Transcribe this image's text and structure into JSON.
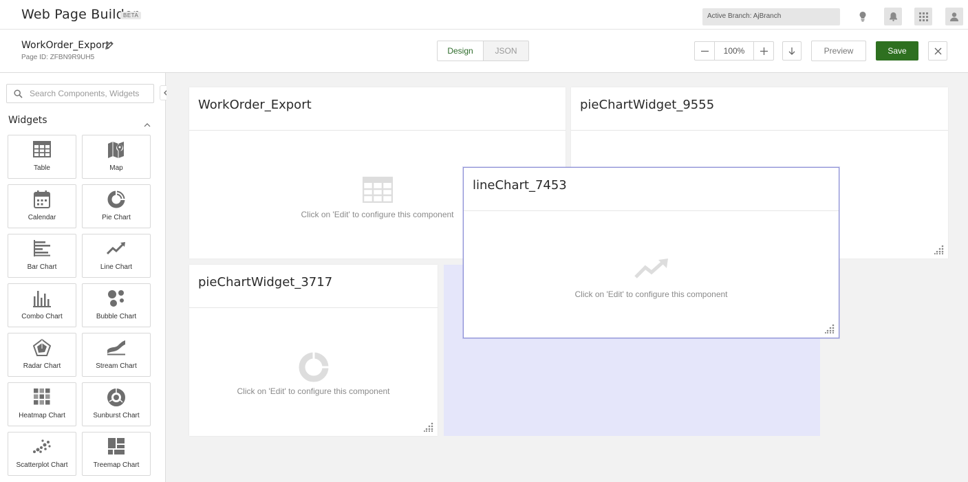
{
  "app": {
    "title": "Web Page Builder",
    "badge": "BETA",
    "active_branch": "Active Branch: AjBranch"
  },
  "page": {
    "name": "WorkOrder_Export",
    "id_label": "Page ID: ZFBN9R9UH5"
  },
  "view_toggle": {
    "design": "Design",
    "json": "JSON",
    "selected": "Design"
  },
  "zoom": {
    "value": "100%"
  },
  "actions": {
    "preview": "Preview",
    "save": "Save"
  },
  "colors": {
    "save": "#2e7020",
    "selected_tab_text": "#2d6b2a",
    "drop_zone": "#e5e6fa",
    "active_border": "#8c8fd6"
  },
  "sidebar": {
    "search_placeholder": "Search Components, Widgets",
    "section_title": "Widgets",
    "widgets": [
      {
        "label": "Table",
        "icon": "table-icon"
      },
      {
        "label": "Map",
        "icon": "map-icon"
      },
      {
        "label": "Calendar",
        "icon": "calendar-icon"
      },
      {
        "label": "Pie Chart",
        "icon": "pie-chart-icon"
      },
      {
        "label": "Bar Chart",
        "icon": "bar-chart-icon"
      },
      {
        "label": "Line Chart",
        "icon": "line-chart-icon"
      },
      {
        "label": "Combo Chart",
        "icon": "combo-chart-icon"
      },
      {
        "label": "Bubble Chart",
        "icon": "bubble-chart-icon"
      },
      {
        "label": "Radar Chart",
        "icon": "radar-chart-icon"
      },
      {
        "label": "Stream Chart",
        "icon": "stream-chart-icon"
      },
      {
        "label": "Heatmap Chart",
        "icon": "heatmap-chart-icon"
      },
      {
        "label": "Sunburst Chart",
        "icon": "sunburst-chart-icon"
      },
      {
        "label": "Scatterplot Chart",
        "icon": "scatterplot-chart-icon"
      },
      {
        "label": "Treemap Chart",
        "icon": "treemap-chart-icon"
      }
    ]
  },
  "canvas": {
    "cards": [
      {
        "title": "WorkOrder_Export",
        "hint": "Click on 'Edit' to configure this component",
        "icon": "table-icon"
      },
      {
        "title": "pieChartWidget_9555",
        "hint": "",
        "icon": ""
      },
      {
        "title": "pieChartWidget_3717",
        "hint": "Click on 'Edit' to configure this component",
        "icon": "pie-chart-icon"
      },
      {
        "title": "lineChart_7453",
        "hint": "Click on 'Edit' to configure this component",
        "icon": "line-chart-icon"
      }
    ]
  }
}
